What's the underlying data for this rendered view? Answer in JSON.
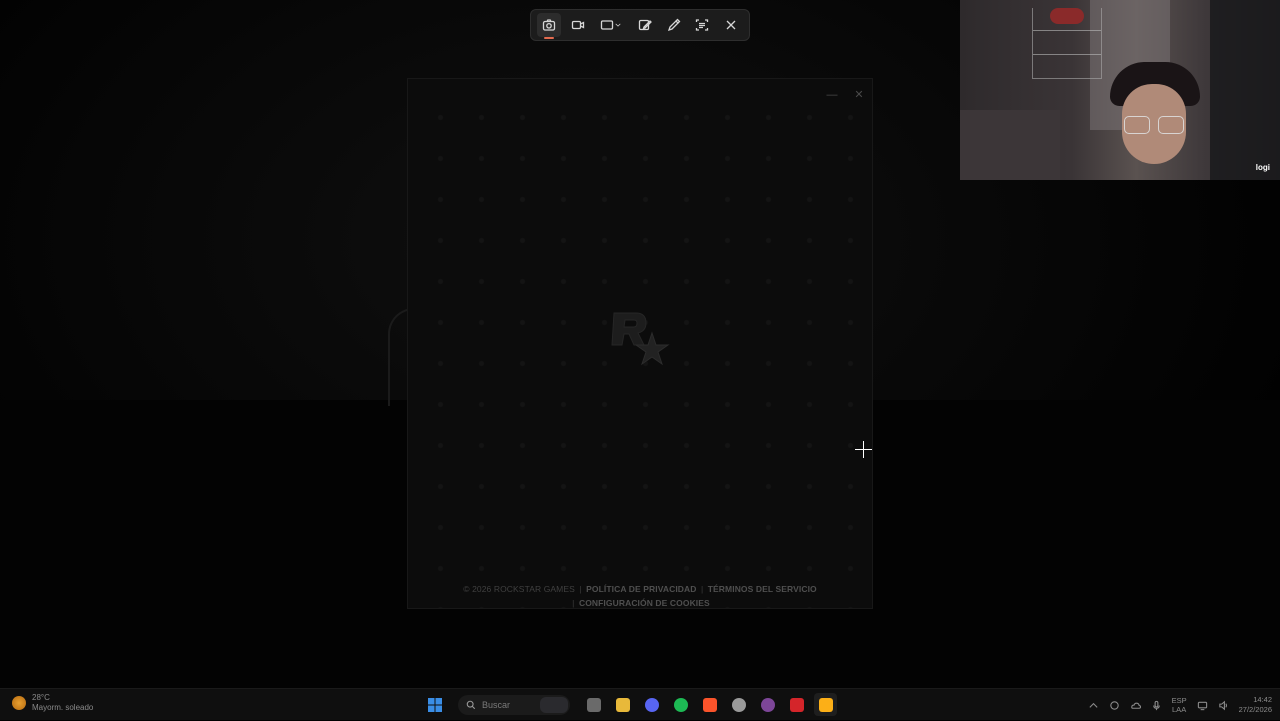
{
  "snipping_toolbar": {
    "buttons": [
      {
        "name": "screenshot-mode",
        "icon": "camera-icon",
        "active": true
      },
      {
        "name": "video-mode",
        "icon": "video-camera-icon",
        "active": false
      },
      {
        "name": "rectangle-mode",
        "icon": "rectangle-select-icon",
        "active": false
      },
      {
        "name": "edit",
        "icon": "edit-image-icon",
        "active": false
      },
      {
        "name": "color-picker",
        "icon": "eyedropper-icon",
        "active": false
      },
      {
        "name": "text-extractor",
        "icon": "text-scan-icon",
        "active": false
      },
      {
        "name": "close",
        "icon": "close-icon",
        "active": false
      }
    ],
    "accent_color": "#e36b4f"
  },
  "launcher": {
    "footer": {
      "copyright": "© 2026 ROCKSTAR GAMES",
      "privacy": "POLÍTICA DE PRIVACIDAD",
      "terms": "TÉRMINOS DEL SERVICIO",
      "cookies": "CONFIGURACIÓN DE COOKIES",
      "separator": "|"
    },
    "minimize_glyph": "—",
    "close_glyph": "✕",
    "logo_icon": "rockstar-logo-icon"
  },
  "webcam": {
    "brand": "logi"
  },
  "taskbar": {
    "weather": {
      "temp": "28°C",
      "desc": "Mayorm. soleado"
    },
    "search_placeholder": "Buscar",
    "apps": [
      {
        "name": "task-view",
        "color": "#6a6a6a"
      },
      {
        "name": "file-explorer",
        "color": "#e8b93a"
      },
      {
        "name": "discord",
        "color": "#5865f2"
      },
      {
        "name": "spotify",
        "color": "#1db954"
      },
      {
        "name": "brave",
        "color": "#fb542b"
      },
      {
        "name": "chrome",
        "color": "#9a9a9a"
      },
      {
        "name": "tor",
        "color": "#7d4698"
      },
      {
        "name": "adobe-acrobat",
        "color": "#d4252a"
      },
      {
        "name": "rockstar-launcher",
        "color": "#fcaf17"
      }
    ],
    "language": {
      "line1": "ESP",
      "line2": "LAA"
    },
    "time": "14:42",
    "date": "27/2/2026"
  }
}
